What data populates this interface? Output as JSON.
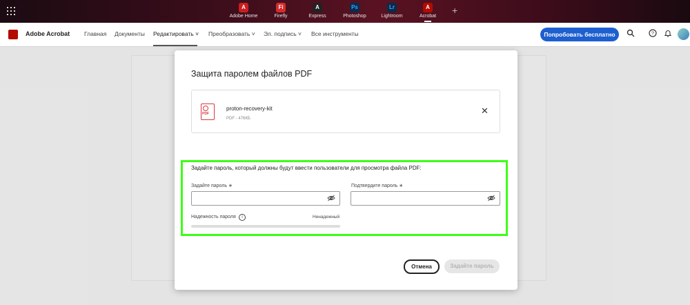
{
  "app_switcher": {
    "apps": [
      {
        "label": "Adobe Home",
        "badge": "A",
        "color": "#c81e1e"
      },
      {
        "label": "Firefly",
        "badge": "Fi",
        "color": "#d62b2b"
      },
      {
        "label": "Express",
        "badge": "A",
        "color": "#222222"
      },
      {
        "label": "Photoshop",
        "badge": "Ps",
        "color": "#0d2a4d"
      },
      {
        "label": "Lightroom",
        "badge": "Lr",
        "color": "#0c2a4a"
      },
      {
        "label": "Acrobat",
        "badge": "A",
        "color": "#b30b00"
      }
    ],
    "active": "Acrobat"
  },
  "nav": {
    "brand": "Adobe Acrobat",
    "items": [
      "Главная",
      "Документы",
      "Редактировать ˅",
      "Преобразовать ˅",
      "Эл. подпись ˅",
      "Все инструменты"
    ],
    "try_button": "Попробовать бесплатно"
  },
  "modal": {
    "title": "Защита паролем файлов PDF",
    "file": {
      "name": "proton-recovery-kit",
      "meta": "PDF - 476КБ",
      "icon_text": "PDF"
    },
    "instruction": "Задайте пароль, который должны будут ввести пользователи для просмотра файла PDF:",
    "password_label": "Задайте пароль ∗",
    "confirm_label": "Подтвердите пароль ∗",
    "strength_label": "Надежность пароля",
    "strength_value": "Ненадежный",
    "cancel": "Отмена",
    "submit": "Задайте пароль"
  }
}
